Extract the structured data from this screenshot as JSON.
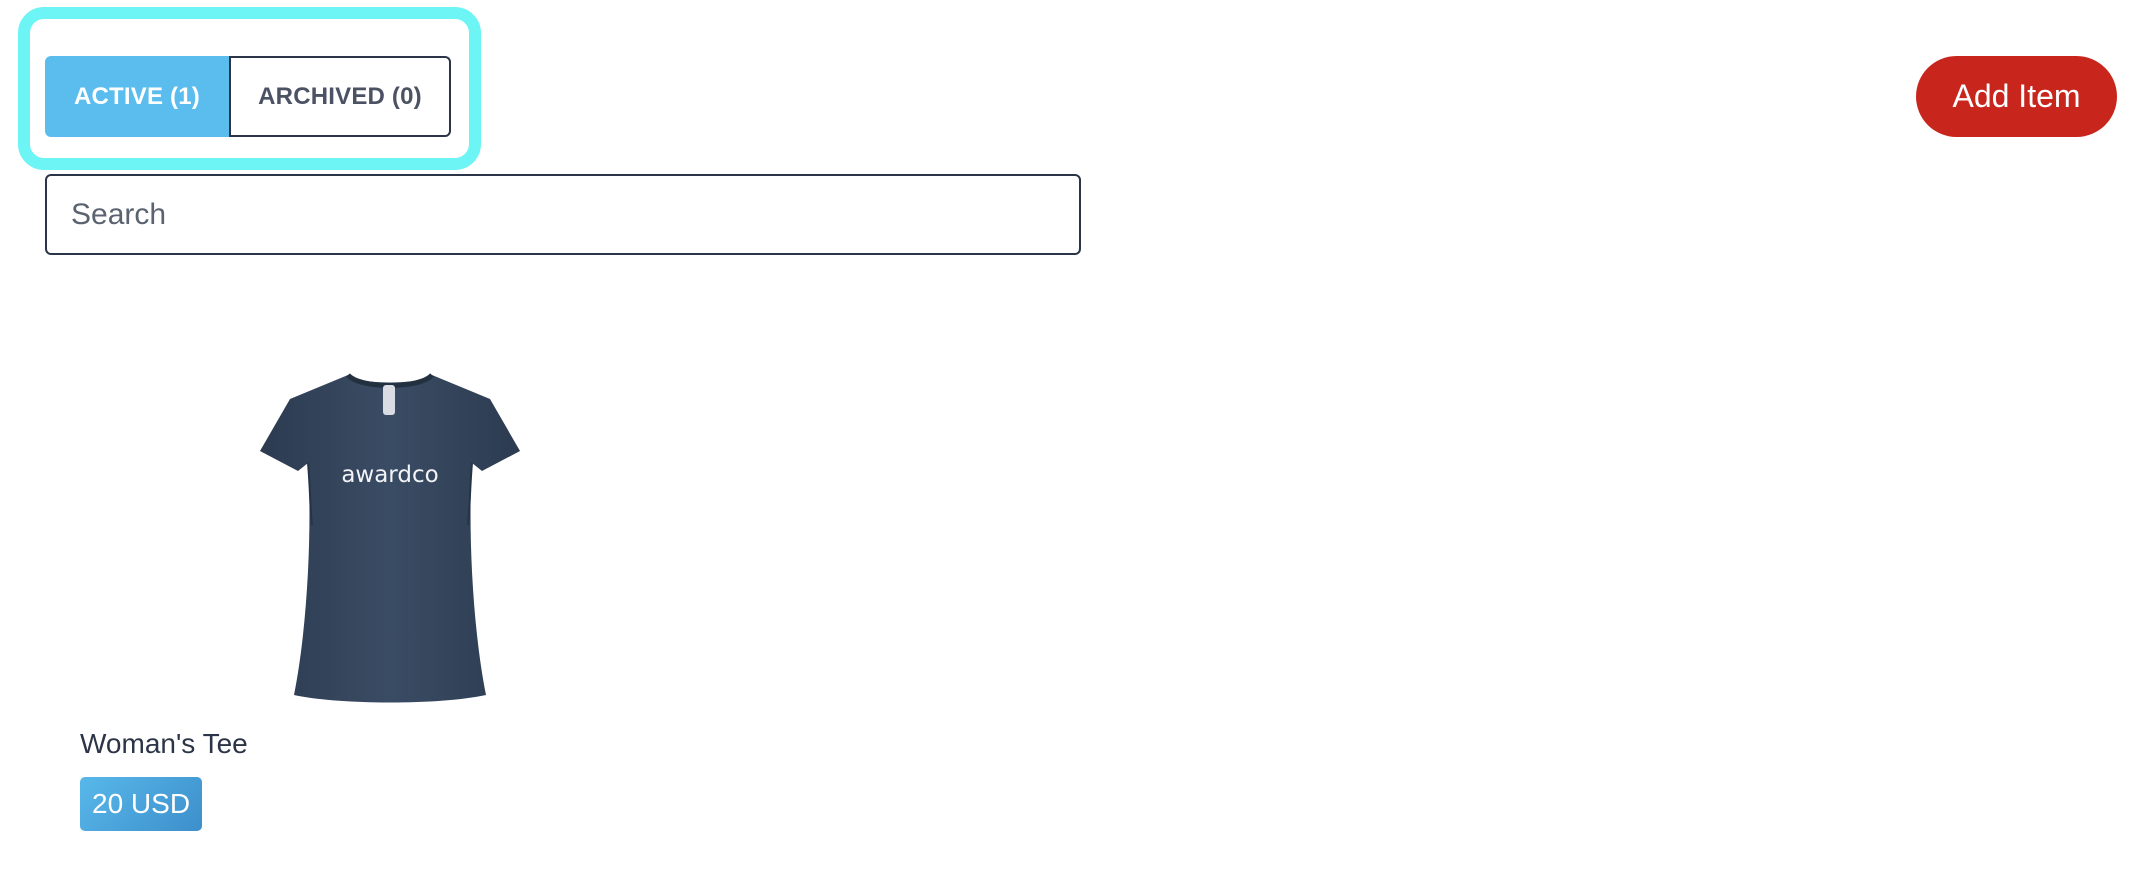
{
  "tabs": {
    "active_label": "ACTIVE (1)",
    "archived_label": "ARCHIVED (0)"
  },
  "toolbar": {
    "add_item_label": "Add Item"
  },
  "search": {
    "placeholder": "Search",
    "value": ""
  },
  "items": [
    {
      "name": "Woman's Tee",
      "price": "20 USD",
      "image_icon": "tshirt-image",
      "image_logo_text": "awardco"
    }
  ],
  "colors": {
    "tab_active_bg": "#5bbdee",
    "add_button_bg": "#c8261d",
    "highlight_ring": "#6df5f5",
    "price_badge_bg": "#4aa6dc",
    "shirt_color": "#34455c"
  }
}
